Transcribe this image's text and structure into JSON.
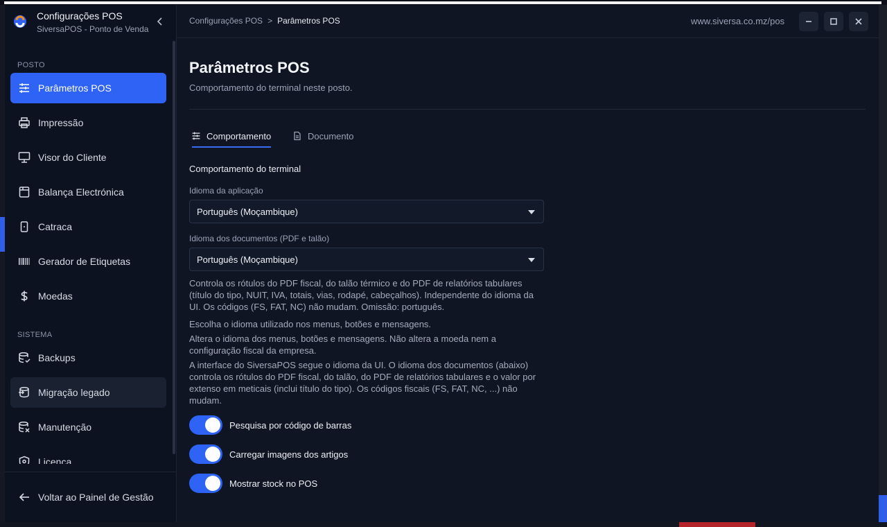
{
  "app": {
    "title": "Configurações POS",
    "subtitle": "SiversaPOS - Ponto de Venda"
  },
  "sidebar": {
    "sections": [
      {
        "label": "POSTO"
      },
      {
        "label": "SISTEMA"
      }
    ],
    "posto_items": [
      {
        "label": "Parâmetros POS",
        "icon": "sliders-icon",
        "active": true
      },
      {
        "label": "Impressão",
        "icon": "printer-icon"
      },
      {
        "label": "Visor do Cliente",
        "icon": "monitor-icon"
      },
      {
        "label": "Balança Electrónica",
        "icon": "scale-icon"
      },
      {
        "label": "Catraca",
        "icon": "turnstile-icon"
      },
      {
        "label": "Gerador de Etiquetas",
        "icon": "barcode-icon"
      },
      {
        "label": "Moedas",
        "icon": "dollar-icon"
      }
    ],
    "sistema_items": [
      {
        "label": "Backups",
        "icon": "database-icon"
      },
      {
        "label": "Migração legado",
        "icon": "database-migrate-icon",
        "hover": true
      },
      {
        "label": "Manutenção",
        "icon": "database-wrench-icon"
      },
      {
        "label": "Licença",
        "icon": "shield-icon"
      }
    ],
    "back_label": "Voltar ao Painel de Gestão"
  },
  "topbar": {
    "breadcrumb_parent": "Configurações POS",
    "breadcrumb_sep": ">",
    "breadcrumb_current": "Parâmetros POS",
    "url": "www.siversa.co.mz/pos"
  },
  "page": {
    "title": "Parâmetros POS",
    "subtitle": "Comportamento do terminal neste posto.",
    "tabs": [
      {
        "label": "Comportamento",
        "active": true
      },
      {
        "label": "Documento",
        "active": false
      }
    ],
    "section_title": "Comportamento do terminal",
    "app_lang_label": "Idioma da aplicação",
    "app_lang_value": "Português (Moçambique)",
    "doc_lang_label": "Idioma dos documentos (PDF e talão)",
    "doc_lang_value": "Português (Moçambique)",
    "help_1": "Controla os rótulos do PDF fiscal, do talão térmico e do PDF de relatórios tabulares (título do tipo, NUIT, IVA, totais, vias, rodapé, cabeçalhos). Independente do idioma da UI. Os códigos (FS, FAT, NC) não mudam. Omissão: português.",
    "help_2": "Escolha o idioma utilizado nos menus, botões e mensagens.",
    "help_3": "Altera o idioma dos menus, botões e mensagens. Não altera a moeda nem a configuração fiscal da empresa.",
    "help_4": "A interface do SiversaPOS segue o idioma da UI. O idioma dos documentos (abaixo) controla os rótulos do PDF fiscal, do talão, do PDF de relatórios tabulares e o valor por extenso em meticais (inclui título do tipo). Os códigos fiscais (FS, FAT, NC, ...) não mudam.",
    "toggles": [
      {
        "label": "Pesquisa por código de barras",
        "on": true
      },
      {
        "label": "Carregar imagens dos artigos",
        "on": true
      },
      {
        "label": "Mostrar stock no POS",
        "on": true
      },
      {
        "label": "",
        "on": true
      }
    ]
  },
  "colors": {
    "accent": "#2f63f5",
    "background": "#0f1523",
    "sidebar": "#0c1220"
  }
}
